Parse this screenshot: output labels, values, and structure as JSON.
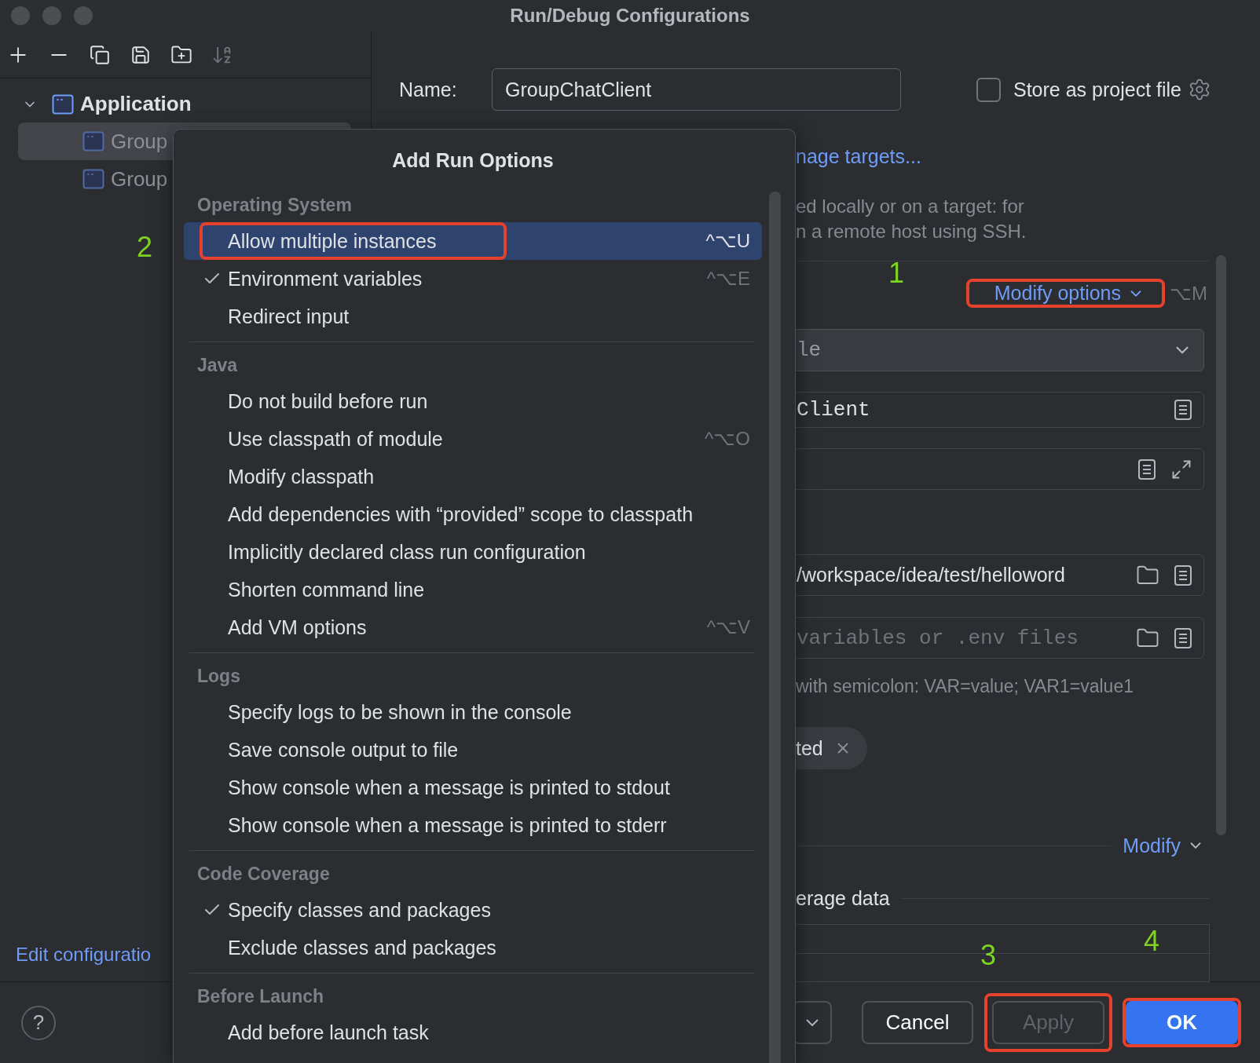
{
  "window": {
    "title": "Run/Debug Configurations"
  },
  "toolbar": [
    {
      "kind": "add",
      "disabled": false
    },
    {
      "kind": "remove",
      "disabled": false
    },
    {
      "kind": "copy",
      "disabled": false
    },
    {
      "kind": "save",
      "disabled": false
    },
    {
      "kind": "folder",
      "disabled": false
    },
    {
      "kind": "sort",
      "disabled": true
    }
  ],
  "tree": [
    {
      "label": "Application",
      "expanded": true,
      "children": [
        {
          "label": "Group",
          "selected": true
        },
        {
          "label": "Group",
          "selected": false
        }
      ]
    }
  ],
  "edit_link": "Edit configuratio",
  "help": "?",
  "name_field": {
    "label": "Name:",
    "value": "GroupChatClient"
  },
  "store_checkbox": {
    "label": "Store as project file",
    "checked": false
  },
  "targets_link": "nage targets...",
  "description": [
    "ed locally or on a target: for",
    "n a remote host using SSH."
  ],
  "modify_options": {
    "label": "Modify options",
    "shortcut": "⌥M",
    "annotated": true
  },
  "fields": [
    {
      "kind": "dropdown",
      "value": "le"
    },
    {
      "kind": "class",
      "value": "Client"
    },
    {
      "kind": "params"
    },
    {
      "kind": "path",
      "value": "/workspace/idea/test/helloword"
    },
    {
      "kind": "env",
      "placeholder": "variables or .env files"
    }
  ],
  "env_hint": "with semicolon: VAR=value; VAR1=value1",
  "chip": {
    "label": "ted"
  },
  "modify_link": "Modify",
  "coverage_heading": "erage data",
  "popup": {
    "title": "Add Run Options",
    "sections": [
      {
        "title": "Operating System",
        "items": [
          {
            "label": "Allow multiple instances",
            "checked": false,
            "selected": true,
            "shortcut": "^⌥U",
            "annotated": true
          },
          {
            "label": "Environment variables",
            "checked": true,
            "selected": false,
            "shortcut": "^⌥E"
          },
          {
            "label": "Redirect input",
            "checked": false,
            "selected": false
          }
        ]
      },
      {
        "title": "Java",
        "items": [
          {
            "label": "Do not build before run",
            "checked": false,
            "selected": false
          },
          {
            "label": "Use classpath of module",
            "checked": false,
            "selected": false,
            "shortcut": "^⌥O"
          },
          {
            "label": "Modify classpath",
            "checked": false,
            "selected": false
          },
          {
            "label": "Add dependencies with “provided” scope to classpath",
            "checked": false,
            "selected": false
          },
          {
            "label": "Implicitly declared class run configuration",
            "checked": false,
            "selected": false
          },
          {
            "label": "Shorten command line",
            "checked": false,
            "selected": false
          },
          {
            "label": "Add VM options",
            "checked": false,
            "selected": false,
            "shortcut": "^⌥V"
          }
        ]
      },
      {
        "title": "Logs",
        "items": [
          {
            "label": "Specify logs to be shown in the console",
            "checked": false,
            "selected": false
          },
          {
            "label": "Save console output to file",
            "checked": false,
            "selected": false
          },
          {
            "label": "Show console when a message is printed to stdout",
            "checked": false,
            "selected": false
          },
          {
            "label": "Show console when a message is printed to stderr",
            "checked": false,
            "selected": false
          }
        ]
      },
      {
        "title": "Code Coverage",
        "items": [
          {
            "label": "Specify classes and packages",
            "checked": true,
            "selected": false
          },
          {
            "label": "Exclude classes and packages",
            "checked": false,
            "selected": false
          }
        ]
      },
      {
        "title": "Before Launch",
        "items": [
          {
            "label": "Add before launch task",
            "checked": false,
            "selected": false
          }
        ]
      }
    ]
  },
  "buttons": [
    {
      "kind": "dropdown"
    },
    {
      "kind": "cancel",
      "label": "Cancel",
      "disabled": false
    },
    {
      "kind": "apply",
      "label": "Apply",
      "disabled": true,
      "annotated": true
    },
    {
      "kind": "ok",
      "label": "OK",
      "disabled": false,
      "annotated": true
    }
  ],
  "annotation_numbers": [
    "1",
    "2",
    "3",
    "4"
  ]
}
